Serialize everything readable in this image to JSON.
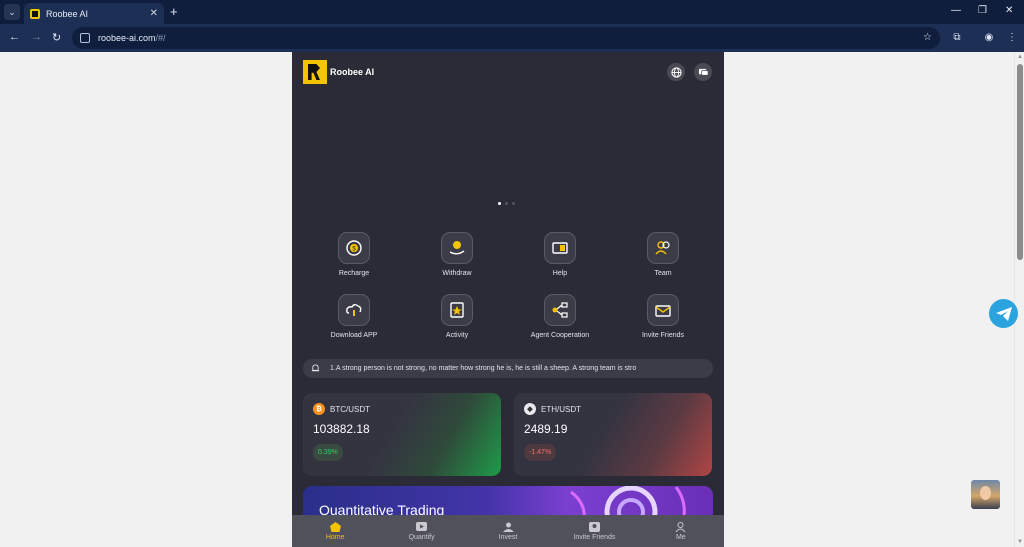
{
  "browser": {
    "tab_title": "Roobee AI",
    "url_host": "roobee-ai.com",
    "url_path": "/#/",
    "icons": [
      "tab-search-icon",
      "close-icon",
      "new-tab-icon",
      "minimize-icon",
      "restore-icon",
      "window-close-icon",
      "back-icon",
      "forward-icon",
      "reload-icon",
      "site-settings-icon",
      "bookmark-star-icon",
      "extensions-icon",
      "profile-icon",
      "more-icon"
    ]
  },
  "app": {
    "name": "Roobee AI",
    "header_icons": [
      "globe-icon",
      "chat-icon"
    ],
    "brand_color": "#f5c400",
    "banner": {
      "slides": 3,
      "active_index": 0
    },
    "menu": [
      {
        "label": "Recharge",
        "icon": "coin-recharge-icon"
      },
      {
        "label": "Withdraw",
        "icon": "hand-coin-icon"
      },
      {
        "label": "Help",
        "icon": "book-icon"
      },
      {
        "label": "Team",
        "icon": "team-icon"
      },
      {
        "label": "Download APP",
        "icon": "cloud-download-icon"
      },
      {
        "label": "Activity",
        "icon": "star-badge-icon"
      },
      {
        "label": "Agent Cooperation",
        "icon": "share-nodes-icon"
      },
      {
        "label": "Invite Friends",
        "icon": "mail-icon"
      }
    ],
    "notice": "1.A strong person is not strong, no matter how strong he is, he is still a sheep. A strong team is stro",
    "tickers": [
      {
        "pair": "BTC/USDT",
        "price": "103882.18",
        "change": "0.39%",
        "direction": "up",
        "coin_icon": "bitcoin-icon"
      },
      {
        "pair": "ETH/USDT",
        "price": "2489.19",
        "change": "-1.47%",
        "direction": "down",
        "coin_icon": "ethereum-icon"
      }
    ],
    "promo_title": "Quantitative Trading",
    "bottom_nav": [
      {
        "label": "Home",
        "icon": "home-icon",
        "active": true
      },
      {
        "label": "Quantify",
        "icon": "quantify-icon",
        "active": false
      },
      {
        "label": "Invest",
        "icon": "invest-icon",
        "active": false
      },
      {
        "label": "Invite Friends",
        "icon": "invite-icon",
        "active": false
      },
      {
        "label": "Me",
        "icon": "user-icon",
        "active": false
      }
    ],
    "status_colors": {
      "up": "#2fd165",
      "down": "#ff6b6b"
    }
  },
  "floating": {
    "telegram_icon": "telegram-icon",
    "support_avatar": "support-avatar"
  }
}
